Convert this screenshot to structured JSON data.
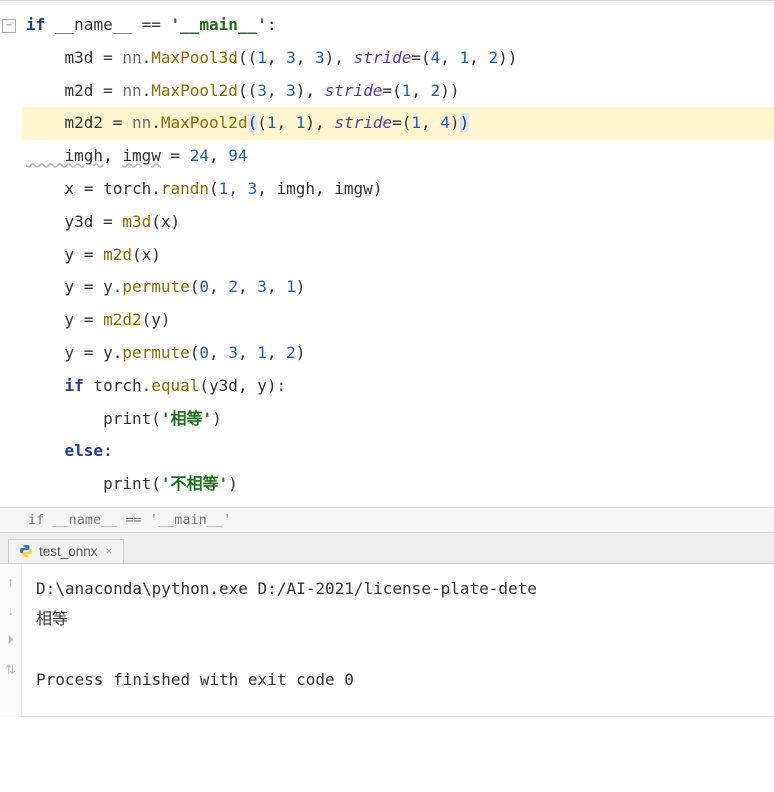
{
  "code": {
    "line1_pre": "if ",
    "line1_name": "__name__",
    "line1_eq": " == ",
    "line1_str": "'__main__'",
    "line1_colon": ":",
    "line2_a": "    m3d = ",
    "line2_b": "nn",
    "line2_c": ".",
    "line2_d": "MaxPool3d",
    "line2_e": "((",
    "line2_f": "1",
    "line2_g": ", ",
    "line2_h": "3",
    "line2_i": ", ",
    "line2_j": "3",
    "line2_k": "), ",
    "line2_l": "stride",
    "line2_m": "=(",
    "line2_n": "4",
    "line2_o": ", ",
    "line2_p": "1",
    "line2_q": ", ",
    "line2_r": "2",
    "line2_s": "))",
    "line3_a": "    m2d = ",
    "line3_b": "nn",
    "line3_c": ".",
    "line3_d": "MaxPool2d",
    "line3_e": "((",
    "line3_f": "3",
    "line3_g": ", ",
    "line3_h": "3",
    "line3_i": "), ",
    "line3_j": "stride",
    "line3_k": "=(",
    "line3_l": "1",
    "line3_m": ", ",
    "line3_n": "2",
    "line3_o": "))",
    "line4_a": "    m2d2 = ",
    "line4_b": "nn",
    "line4_c": ".",
    "line4_d": "MaxPool2d",
    "line4_e": "(",
    "line4_f": "(",
    "line4_g": "1",
    "line4_h": ", ",
    "line4_i": "1",
    "line4_j": "), ",
    "line4_k": "stride",
    "line4_l": "=(",
    "line4_m": "1",
    "line4_n": ", ",
    "line4_o": "4",
    "line4_p": ")",
    "line4_q": ")",
    "line5_a": "    imgh",
    "line5_b": ", ",
    "line5_c": "imgw",
    "line5_d": " = ",
    "line5_e": "24",
    "line5_f": ", ",
    "line5_g": "94",
    "line6_a": "    x = torch.",
    "line6_b": "randn",
    "line6_c": "(",
    "line6_d": "1",
    "line6_e": ", ",
    "line6_f": "3",
    "line6_g": ", imgh, imgw)",
    "line7_a": "    y3d = ",
    "line7_b": "m3d",
    "line7_c": "(x)",
    "line8_a": "    y = ",
    "line8_b": "m2d",
    "line8_c": "(x)",
    "line9_a": "    y = y.",
    "line9_b": "permute",
    "line9_c": "(",
    "line9_d": "0",
    "line9_e": ", ",
    "line9_f": "2",
    "line9_g": ", ",
    "line9_h": "3",
    "line9_i": ", ",
    "line9_j": "1",
    "line9_k": ")",
    "line10_a": "    y = ",
    "line10_b": "m2d2",
    "line10_c": "(y)",
    "line11_a": "    y = y.",
    "line11_b": "permute",
    "line11_c": "(",
    "line11_d": "0",
    "line11_e": ", ",
    "line11_f": "3",
    "line11_g": ", ",
    "line11_h": "1",
    "line11_i": ", ",
    "line11_j": "2",
    "line11_k": ")",
    "line12_a": "    ",
    "line12_b": "if",
    "line12_c": " torch.",
    "line12_d": "equal",
    "line12_e": "(y3d, y):",
    "line13_a": "        print(",
    "line13_b": "'相等'",
    "line13_c": ")",
    "line14_a": "    ",
    "line14_b": "else",
    "line14_c": ":",
    "line15_a": "        print(",
    "line15_b": "'不相等'",
    "line15_c": ")"
  },
  "breadcrumb": "if __name__ == '__main__'",
  "tab": {
    "label": "test_onnx",
    "close": "×"
  },
  "console": {
    "cmd": "D:\\anaconda\\python.exe D:/AI-2021/license-plate-dete",
    "out1": "相等",
    "blank": "",
    "out2": "Process finished with exit code 0"
  },
  "gutter": {
    "g1": "↑",
    "g2": "↓",
    "g3": "⏵",
    "g4": "⇅"
  },
  "fold": "−"
}
